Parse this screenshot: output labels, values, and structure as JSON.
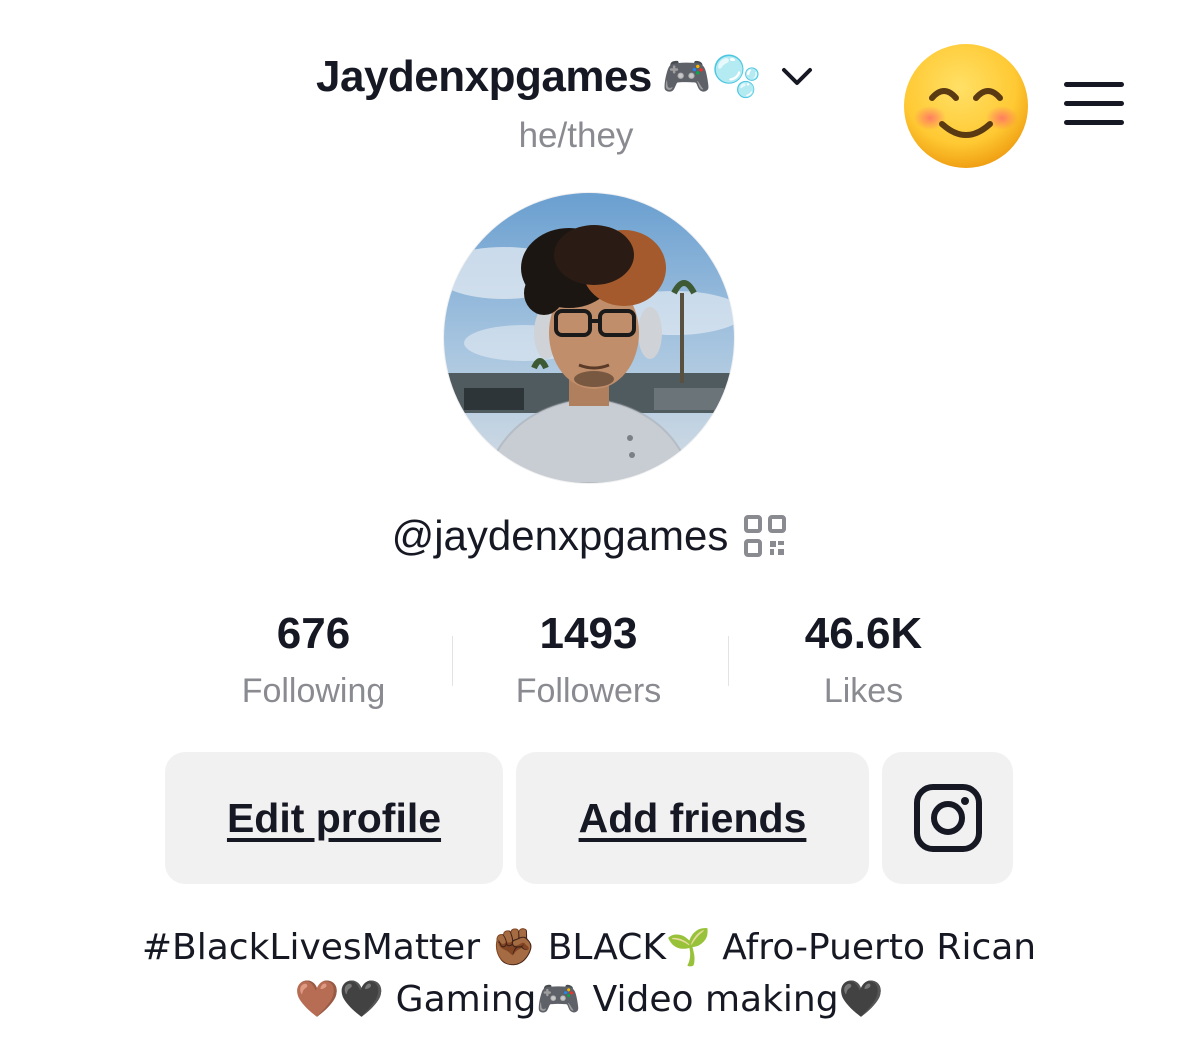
{
  "header": {
    "display_name": "Jaydenxpgames",
    "name_emojis": "🎮🫧",
    "pronouns": "he/they"
  },
  "profile": {
    "username": "@jaydenxpgames"
  },
  "stats": [
    {
      "value": "676",
      "label": "Following"
    },
    {
      "value": "1493",
      "label": "Followers"
    },
    {
      "value": "46.6K",
      "label": "Likes"
    }
  ],
  "actions": {
    "edit_label": "Edit profile",
    "add_friends_label": "Add friends"
  },
  "bio": {
    "line1": "#BlackLivesMatter ✊🏾 BLACK🌱 Afro-Puerto Rican",
    "line2": "🤎🖤 Gaming🎮 Video making🖤"
  },
  "icons": {
    "chevron": "chevron-down-icon",
    "smiley": "smiling-face-icon",
    "menu": "hamburger-menu-icon",
    "qr": "qr-code-icon",
    "instagram": "instagram-icon"
  },
  "colors": {
    "text_primary": "#161823",
    "text_secondary": "#8a8b91",
    "button_bg": "#f1f1f2"
  }
}
